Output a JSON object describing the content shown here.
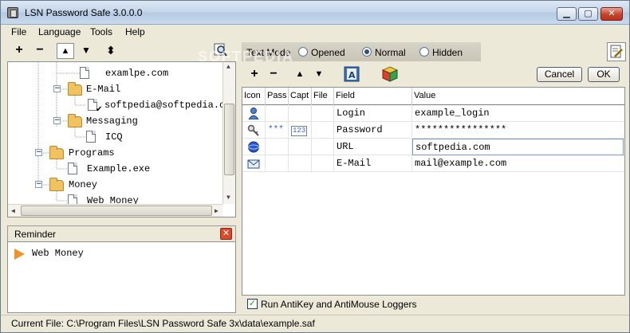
{
  "window": {
    "title": "LSN Password Safe 3.0.0.0",
    "minimize_glyph": "▁",
    "maximize_glyph": "▢",
    "close_glyph": "✕"
  },
  "menu": {
    "items": [
      "File",
      "Language",
      "Tools",
      "Help"
    ]
  },
  "left_toolbar": {
    "add": "+",
    "remove": "−",
    "move_up": "▲",
    "move_down": "▼",
    "sort": "⬍"
  },
  "tree": {
    "items": [
      {
        "label": "examlpe.com",
        "type": "doc"
      },
      {
        "label": "E-Mail",
        "type": "folder",
        "expander": "−"
      },
      {
        "label": "softpedia@softpedia.c",
        "type": "doc"
      },
      {
        "label": "Messaging",
        "type": "folder",
        "expander": "−"
      },
      {
        "label": "ICQ",
        "type": "doc"
      },
      {
        "label": "Programs",
        "type": "folder",
        "expander": "−"
      },
      {
        "label": "Example.exe",
        "type": "doc"
      },
      {
        "label": "Money",
        "type": "folder",
        "expander": "−"
      },
      {
        "label": "Web Money",
        "type": "doc"
      }
    ]
  },
  "reminder": {
    "title": "Reminder",
    "close": "✕",
    "items": [
      "Web Money"
    ]
  },
  "text_mode": {
    "label": "Text Mode",
    "options": [
      "Opened",
      "Normal",
      "Hidden"
    ],
    "selected": "Normal"
  },
  "right_toolbar": {
    "add": "+",
    "remove": "−",
    "move_up": "▲",
    "move_down": "▼",
    "cancel_label": "Cancel",
    "ok_label": "OK"
  },
  "grid": {
    "headers": [
      "Icon",
      "Pass",
      "Capt",
      "File",
      "Field",
      "Value"
    ],
    "rows": [
      {
        "icon": "user-icon",
        "pass": "",
        "capt": "",
        "field": "Login",
        "value": "example_login"
      },
      {
        "icon": "key-icon",
        "pass": "***",
        "capt": "123",
        "field": "Password",
        "value": "****************"
      },
      {
        "icon": "globe-icon",
        "pass": "",
        "capt": "",
        "field": "URL",
        "value": "softpedia.com"
      },
      {
        "icon": "mail-icon",
        "pass": "",
        "capt": "",
        "field": "E-Mail",
        "value": "mail@example.com"
      }
    ]
  },
  "antikey": {
    "label": "Run AntiKey and AntiMouse Loggers",
    "checked": true,
    "check_glyph": "✓"
  },
  "status": {
    "text": "Current File: C:\\Program Files\\LSN Password Safe 3x\\data\\example.saf"
  },
  "watermark": {
    "text": "SOFTPEDIA"
  }
}
